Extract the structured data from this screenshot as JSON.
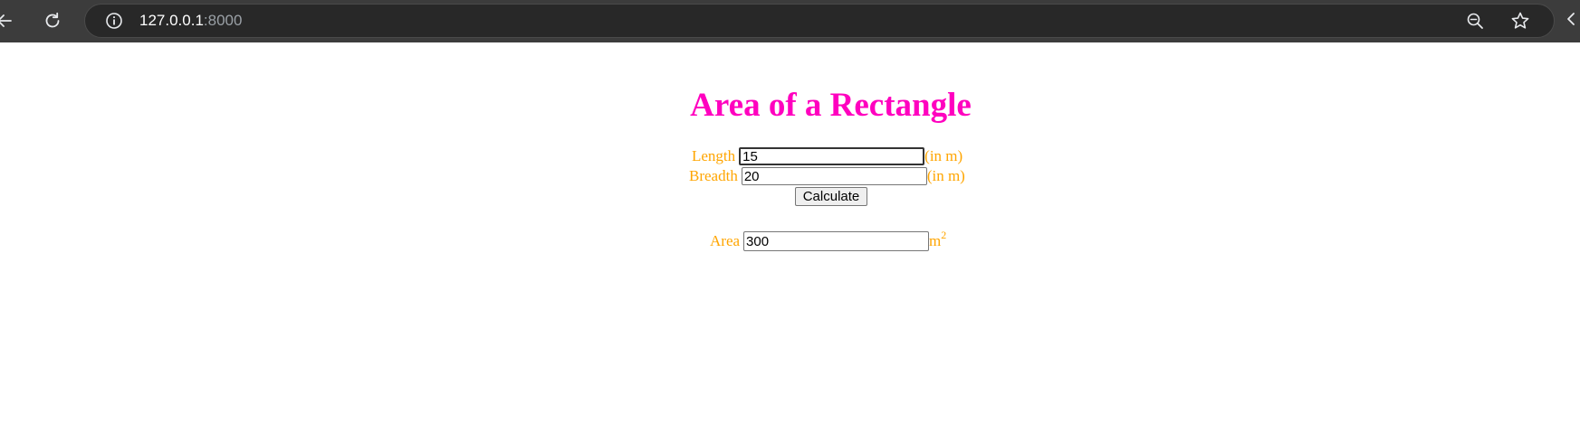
{
  "browser": {
    "url_host": "127.0.0.1",
    "url_port": ":8000",
    "icons": {
      "back": "arrow-left-icon",
      "reload": "reload-icon",
      "site_info": "info-icon",
      "zoom": "zoom-out-icon",
      "bookmark": "star-icon"
    }
  },
  "page": {
    "title": "Area of a Rectangle",
    "length": {
      "label": "Length",
      "value": "15",
      "unit": "(in m)"
    },
    "breadth": {
      "label": "Breadth",
      "value": "20",
      "unit": "(in m)"
    },
    "calculate_label": "Calculate",
    "area": {
      "label": "Area",
      "value": "300",
      "unit_base": "m",
      "unit_exp": "2"
    }
  },
  "colors": {
    "title": "#ff00bf",
    "labels": "#ffa500",
    "chrome_bg": "#3c3c3c",
    "omnibox_bg": "#282828"
  }
}
